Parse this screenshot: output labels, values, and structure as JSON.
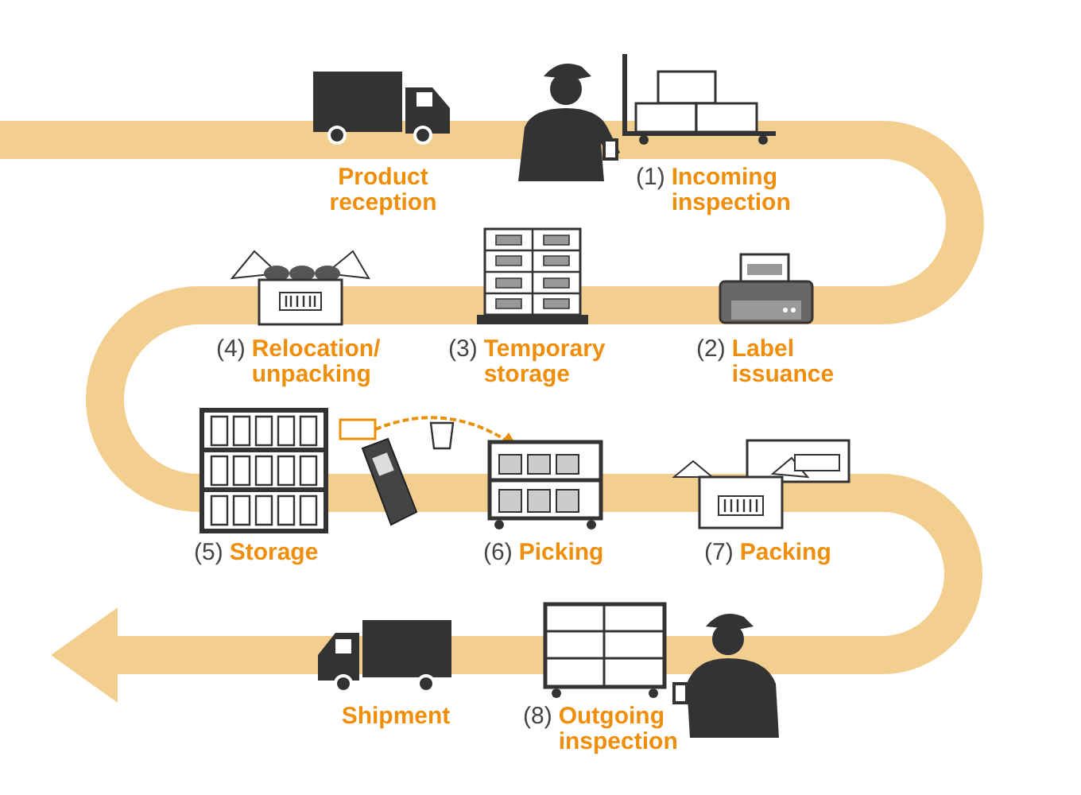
{
  "steps": [
    {
      "label": "Product reception"
    },
    {
      "number": "(1)",
      "label": "Incoming inspection"
    },
    {
      "number": "(4)",
      "label": "Relocation/ unpacking"
    },
    {
      "number": "(3)",
      "label": "Temporary storage"
    },
    {
      "number": "(2)",
      "label": "Label issuance"
    },
    {
      "number": "(5)",
      "label": "Storage"
    },
    {
      "number": "(6)",
      "label": "Picking"
    },
    {
      "number": "(7)",
      "label": "Packing"
    },
    {
      "label": "Shipment"
    },
    {
      "number": "(8)",
      "label": "Outgoing inspection"
    }
  ]
}
